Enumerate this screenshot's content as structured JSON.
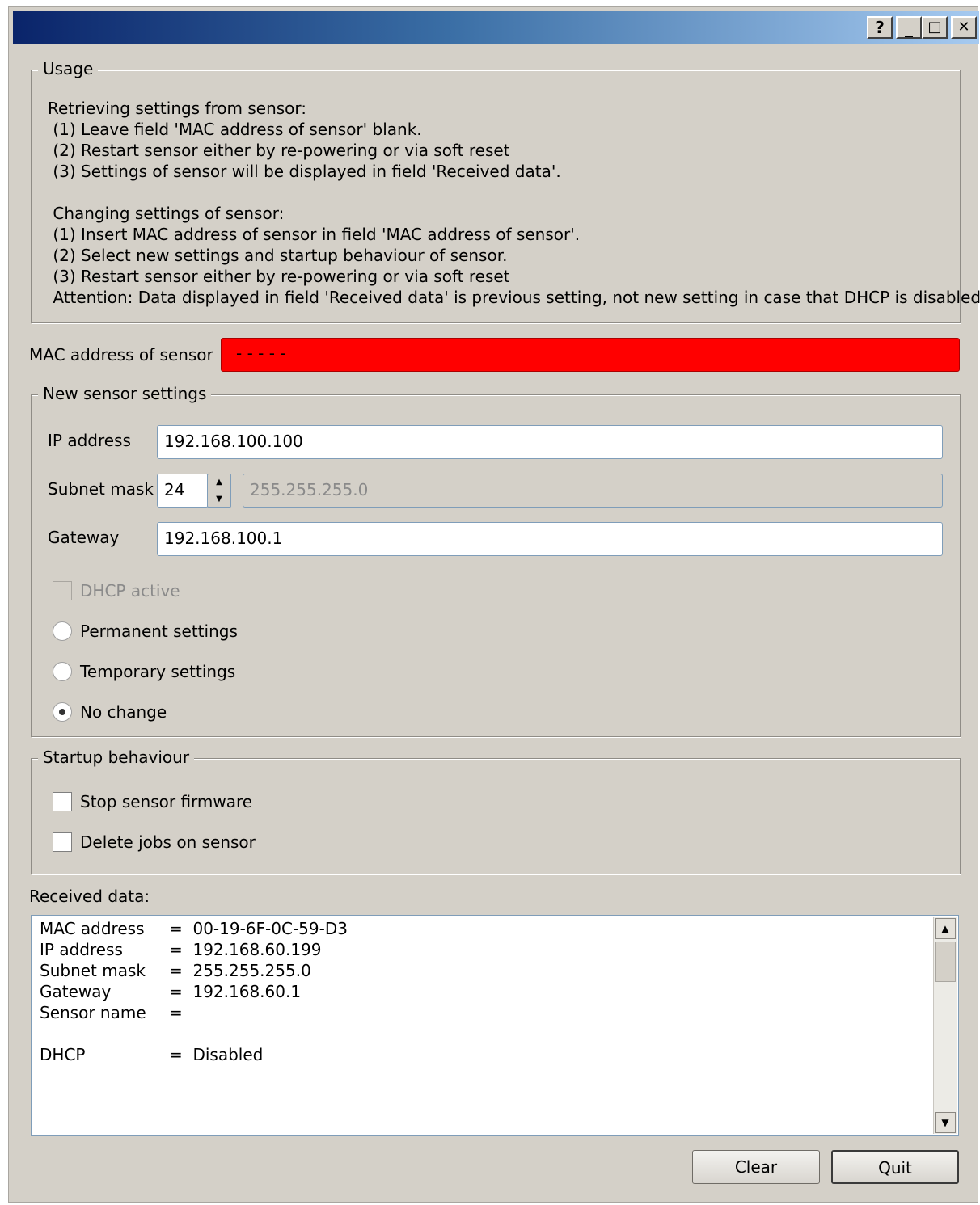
{
  "window": {
    "title": "",
    "help_label": "?",
    "minimize_label": "_",
    "maximize_label": "□",
    "close_label": "✕"
  },
  "usage": {
    "legend": "Usage",
    "lines": [
      "Retrieving settings from sensor:",
      " (1) Leave field 'MAC address of sensor' blank.",
      " (2) Restart sensor either by re-powering or via soft reset",
      " (3) Settings of sensor will be displayed in field 'Received data'.",
      "",
      " Changing settings of sensor:",
      " (1) Insert MAC address of sensor in field 'MAC address of sensor'.",
      " (2) Select new settings and startup behaviour of sensor.",
      " (3) Restart sensor either by re-powering or via soft reset",
      " Attention: Data displayed in field 'Received data' is previous setting, not new setting in case that DHCP is disabled."
    ]
  },
  "mac": {
    "label": "MAC address of sensor",
    "value": "- - - - -",
    "bg_color": "#ff0000"
  },
  "new_settings": {
    "legend": "New sensor settings",
    "ip_label": "IP address",
    "ip_value": "192.168.100.100",
    "subnet_label": "Subnet mask",
    "subnet_prefix": "24",
    "subnet_value": "255.255.255.0",
    "gateway_label": "Gateway",
    "gateway_value": "192.168.100.1",
    "dhcp_label": "DHCP active",
    "permanent_label": "Permanent settings",
    "temporary_label": "Temporary settings",
    "nochange_label": "No change",
    "selected_option": "No change"
  },
  "startup": {
    "legend": "Startup behaviour",
    "stop_firmware_label": "Stop sensor firmware",
    "delete_jobs_label": "Delete jobs on sensor"
  },
  "received": {
    "label": "Received data:",
    "rows": [
      {
        "key": "MAC address",
        "value": "=  00-19-6F-0C-59-D3"
      },
      {
        "key": "IP address",
        "value": "=  192.168.60.199"
      },
      {
        "key": "Subnet mask",
        "value": "=  255.255.255.0"
      },
      {
        "key": "Gateway",
        "value": "=  192.168.60.1"
      },
      {
        "key": "Sensor name",
        "value": "="
      },
      {
        "key": "",
        "value": ""
      },
      {
        "key": "DHCP",
        "value": "=  Disabled"
      }
    ]
  },
  "buttons": {
    "clear_label": "Clear",
    "quit_label": "Quit"
  },
  "icons": {
    "scroll_up": "scroll-up-arrow-icon",
    "scroll_down": "scroll-down-arrow-icon",
    "spin_up": "spin-up-arrow-icon",
    "spin_down": "spin-down-arrow-icon"
  }
}
